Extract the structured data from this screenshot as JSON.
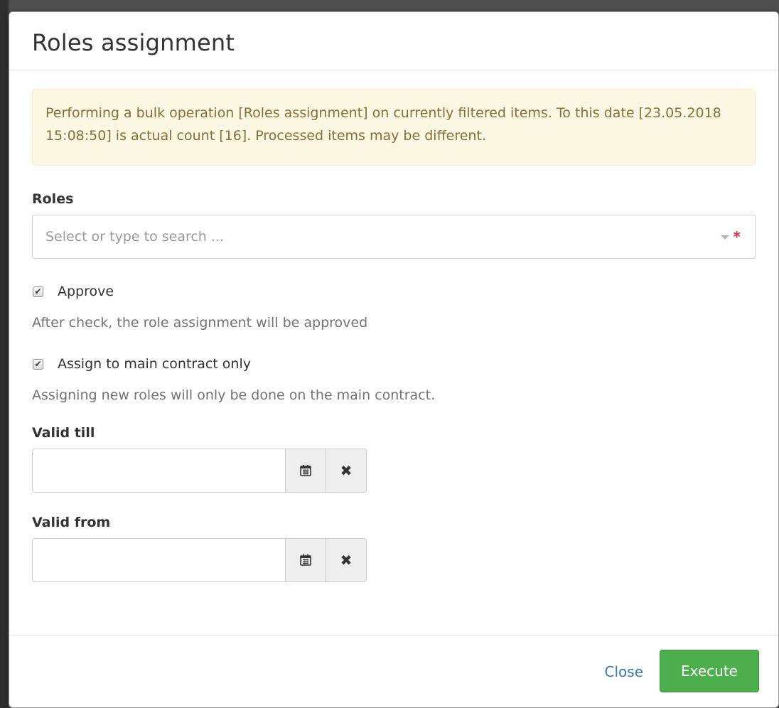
{
  "modal": {
    "title": "Roles assignment",
    "alert_text": "Performing a bulk operation [Roles assignment] on currently filtered items. To this date [23.05.2018 15:08:50] is actual count [16]. Processed items may be different."
  },
  "roles": {
    "label": "Roles",
    "placeholder": "Select or type to search ...",
    "required_marker": "*"
  },
  "approve": {
    "label": "Approve",
    "checked": true,
    "help": "After check, the role assignment will be approved"
  },
  "main_contract": {
    "label": "Assign to main contract only",
    "checked": true,
    "help": "Assigning new roles will only be done on the main contract."
  },
  "valid_till": {
    "label": "Valid till",
    "value": "",
    "calendar_icon": "calendar-icon",
    "clear_icon": "times-icon"
  },
  "valid_from": {
    "label": "Valid from",
    "value": "",
    "calendar_icon": "calendar-icon",
    "clear_icon": "times-icon"
  },
  "footer": {
    "close_label": "Close",
    "execute_label": "Execute"
  },
  "colors": {
    "alert_bg": "#fcf8e3",
    "alert_text": "#8a6d3b",
    "primary_link": "#337ab7",
    "success": "#4cae4c",
    "required": "#e0324b"
  }
}
